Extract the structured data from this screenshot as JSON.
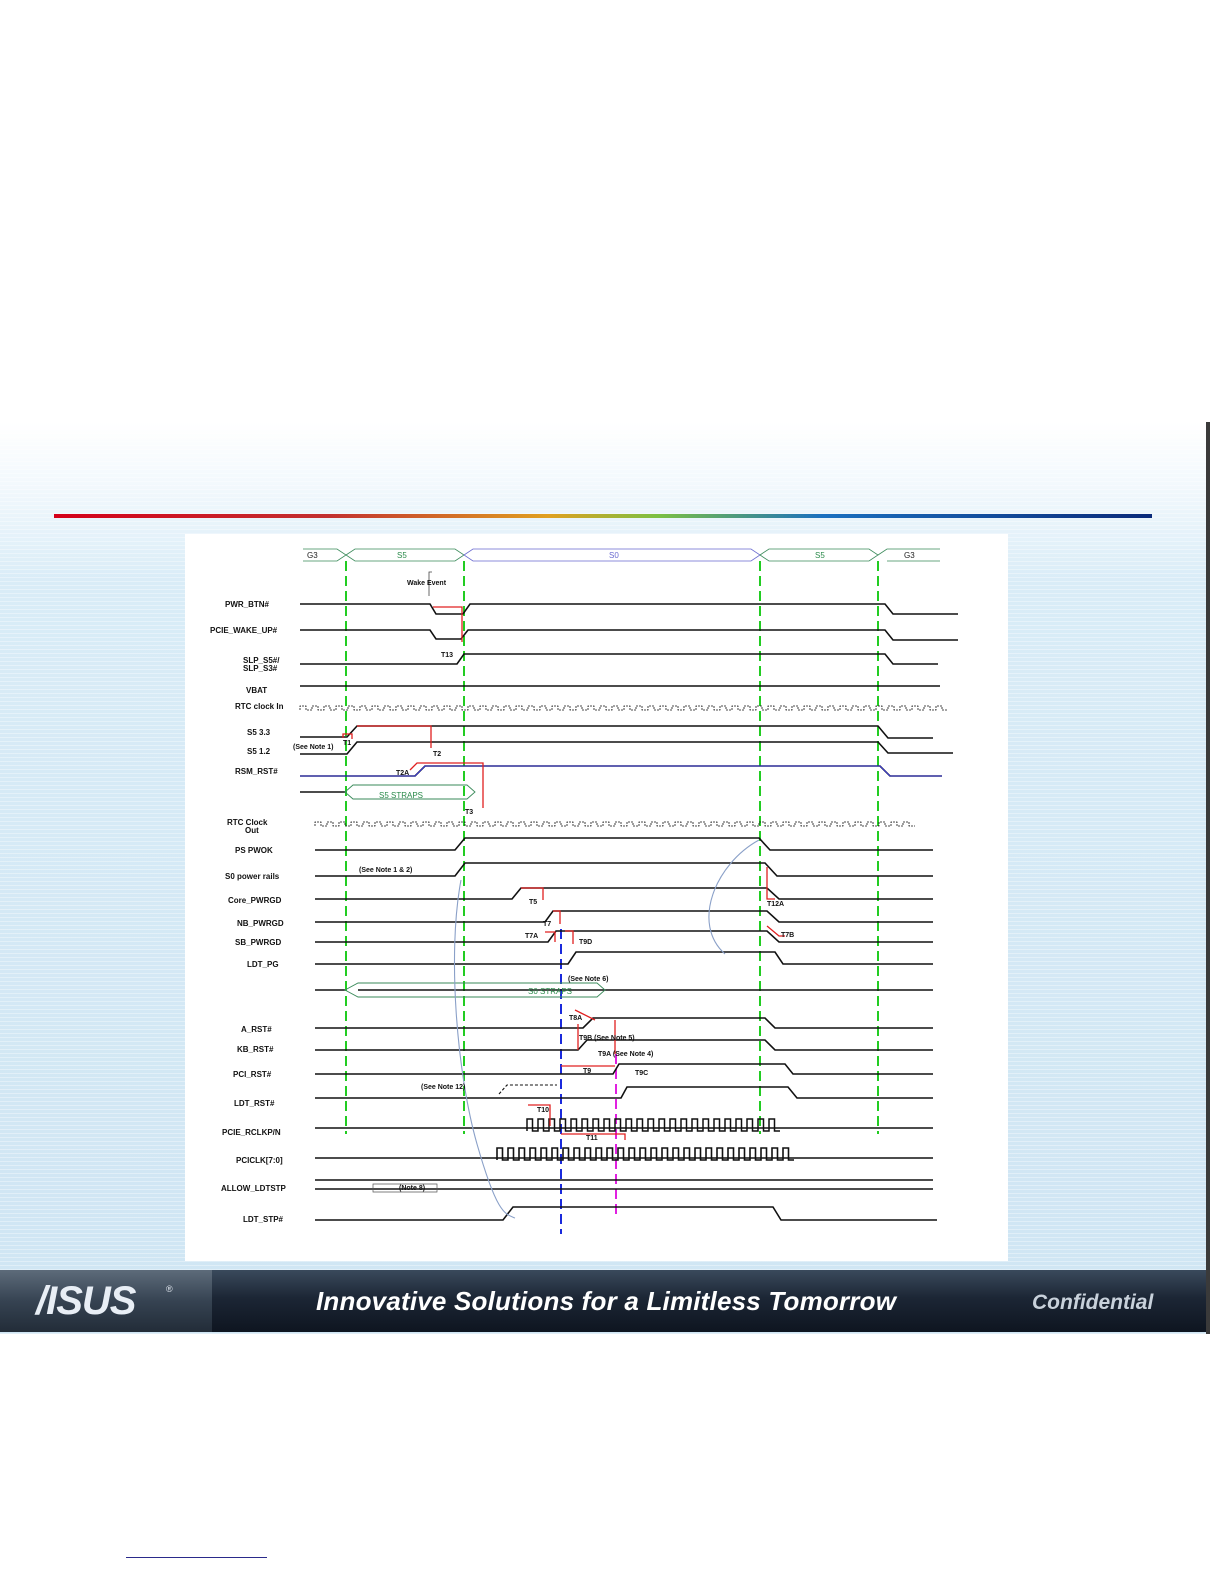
{
  "footer": {
    "logo": "/ISUS",
    "tagline": "Innovative Solutions for a Limitless Tomorrow",
    "confidential": "Confidential"
  },
  "diagram": {
    "states": [
      "G3",
      "S5",
      "S0",
      "S5",
      "G3"
    ],
    "signals": [
      "PWR_BTN#",
      "PCIE_WAKE_UP#",
      "SLP_S5#/",
      "SLP_S3#",
      "VBAT",
      "RTC clock In",
      "S5 3.3",
      "S5 1.2",
      "RSM_RST#",
      "RTC Clock",
      "Out",
      "PS PWOK",
      "S0 power rails",
      "Core_PWRGD",
      "NB_PWRGD",
      "SB_PWRGD",
      "LDT_PG",
      "A_RST#",
      "KB_RST#",
      "PCI_RST#",
      "LDT_RST#",
      "PCIE_RCLKP/N",
      "PCICLK[7:0]",
      "ALLOW_LDTSTP",
      "LDT_STP#"
    ],
    "annotations": {
      "wake_event": "Wake Event",
      "t13": "T13",
      "t1": "T1",
      "t2": "T2",
      "t2a": "T2A",
      "t3": "T3",
      "see_note_1": "(See Note 1)",
      "s5_straps": "S5 STRAPS",
      "see_note_1_2": "(See Note 1 & 2)",
      "t5": "T5",
      "t7": "T7",
      "t7a": "T7A",
      "t9d": "T9D",
      "t12a": "T12A",
      "t7b": "T7B",
      "see_note_6": "(See Note 6)",
      "s0_straps": "S0 STRAPS",
      "t8a": "T8A",
      "t9b_note5": "T9B (See Note 5)",
      "t9a_note4": "T9A  (See Note 4)",
      "t9": "T9",
      "t9c": "T9C",
      "see_note_12": "(See Note 12)",
      "t10": "T10",
      "t11": "T11",
      "note_8": "(Note 8)"
    }
  },
  "colors": {
    "signal": "#111111",
    "timing": "#e02020",
    "state_marker": "#22cc22",
    "reset_marker": "#1a2adc",
    "pci_marker": "#e020e0",
    "rsm_line": "#3a3ad8",
    "curve": "#8aa0c8"
  }
}
